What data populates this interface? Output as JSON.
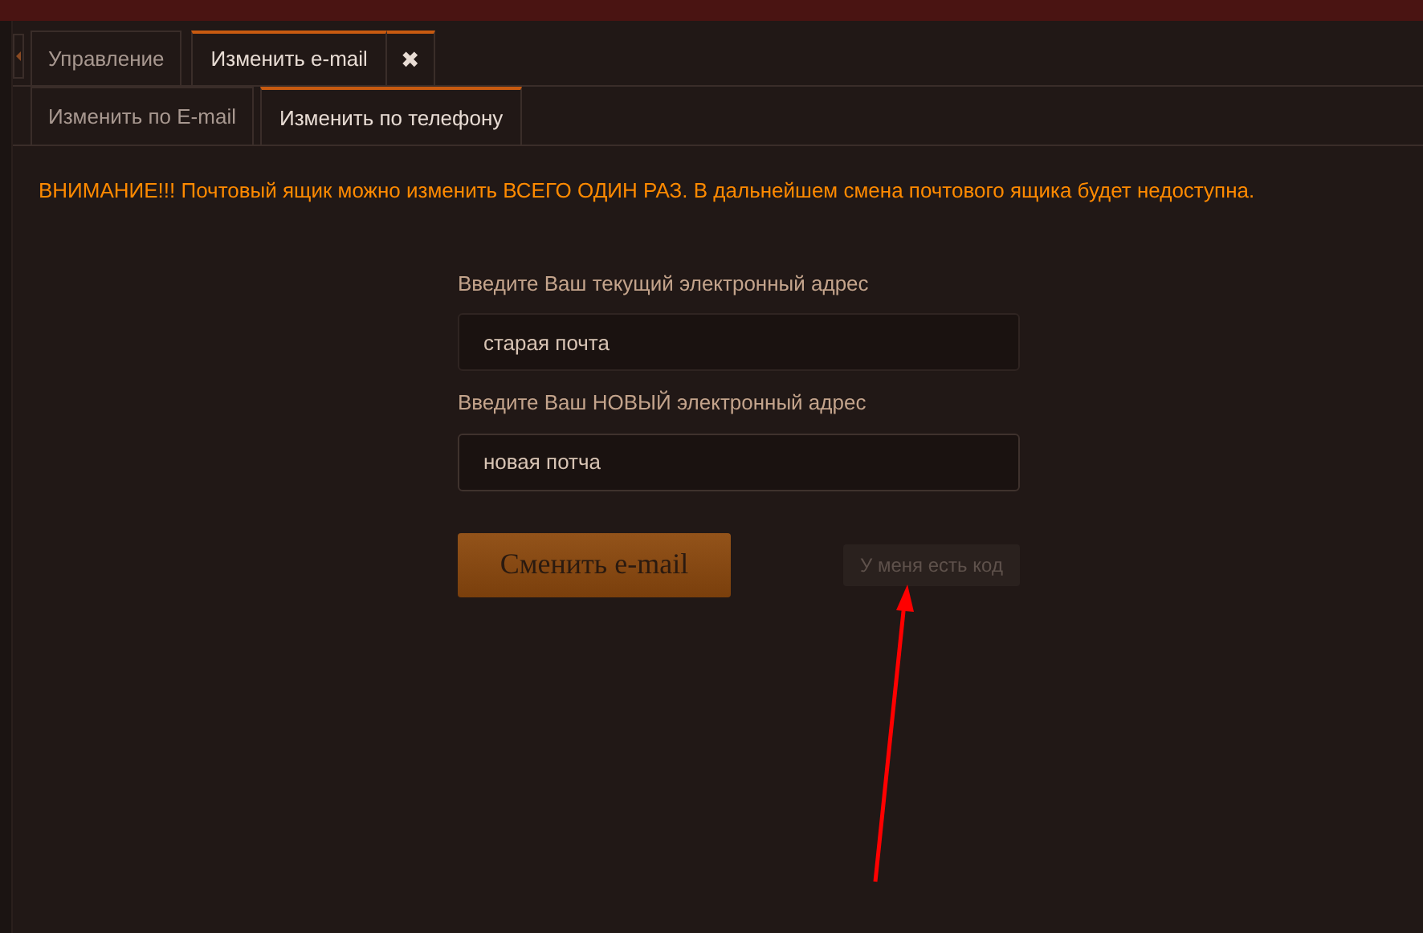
{
  "tabs": [
    {
      "label": "Управление",
      "selected": false
    },
    {
      "label": "Изменить e-mail",
      "selected": true,
      "closable": true,
      "close_glyph": "✖"
    }
  ],
  "subtabs": [
    {
      "label": "Изменить по E-mail",
      "selected": false
    },
    {
      "label": "Изменить по телефону",
      "selected": true
    }
  ],
  "warning": "ВНИМАНИЕ!!! Почтовый ящик можно изменить ВСЕГО ОДИН РАЗ. В дальнейшем смена почтового ящика будет недоступна.",
  "fields": [
    {
      "label": "Введите Ваш текущий электронный адрес",
      "value": "старая почта",
      "focused": false
    },
    {
      "label": "Введите Ваш НОВЫЙ электронный адрес",
      "value": "новая потча",
      "focused": true
    }
  ],
  "submit_button": "Сменить e-mail",
  "code_button": "У меня есть код"
}
